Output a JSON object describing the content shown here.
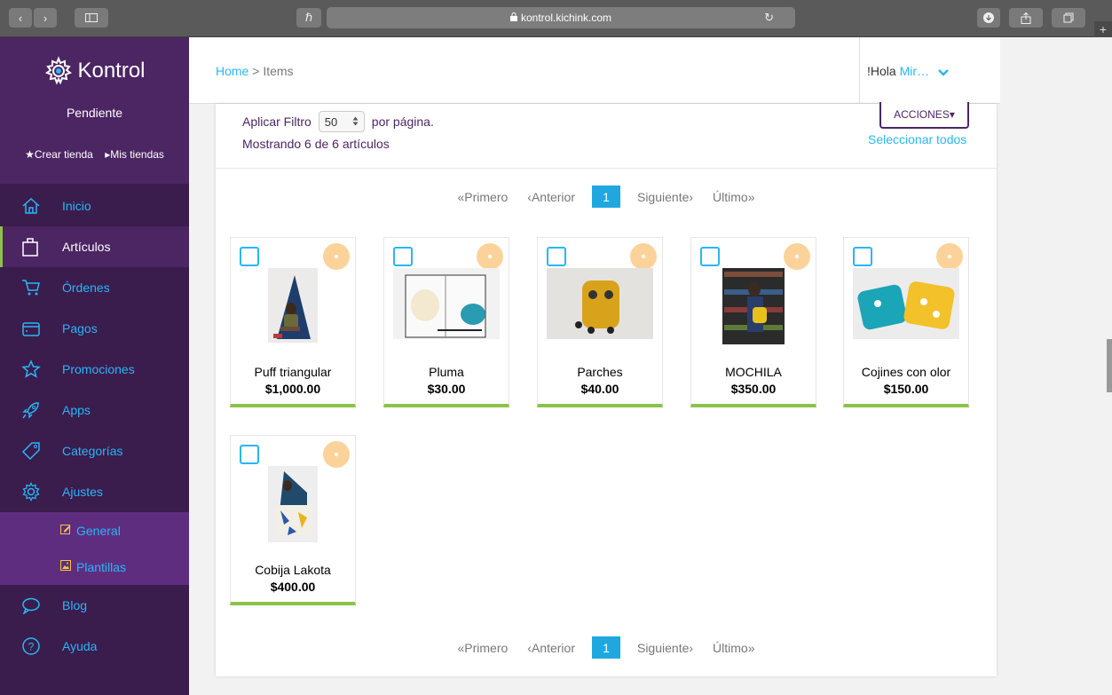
{
  "browser": {
    "url": "kontrol.kichink.com",
    "reader_label": "ℏ"
  },
  "app": {
    "name": "Kontrol"
  },
  "store": {
    "status": "Pendiente",
    "create_label": "★Crear tienda",
    "stores_label": "▸Mis tiendas"
  },
  "nav": {
    "items": [
      {
        "label": "Inicio",
        "icon": "home-icon"
      },
      {
        "label": "Artículos",
        "icon": "bag-icon"
      },
      {
        "label": "Órdenes",
        "icon": "cart-icon"
      },
      {
        "label": "Pagos",
        "icon": "wallet-icon"
      },
      {
        "label": "Promociones",
        "icon": "star-icon"
      },
      {
        "label": "Apps",
        "icon": "rocket-icon"
      },
      {
        "label": "Categorías",
        "icon": "tag-icon"
      },
      {
        "label": "Ajustes",
        "icon": "gear-icon"
      }
    ],
    "subitems": [
      {
        "label": "General",
        "icon": "edit-icon"
      },
      {
        "label": "Plantillas",
        "icon": "image-icon"
      }
    ],
    "bottom": [
      {
        "label": "Blog",
        "icon": "chat-icon"
      },
      {
        "label": "Ayuda",
        "icon": "help-icon"
      }
    ]
  },
  "header": {
    "breadcrumb_home": "Home",
    "breadcrumb_sep": " > ",
    "breadcrumb_current": "Items",
    "greeting": "!Hola ",
    "user": "Mir…",
    "chevron": "❯"
  },
  "toolbar": {
    "filter_label": "Aplicar Filtro",
    "per_page_value": "50",
    "per_page_suffix": "por página.",
    "showing": "Mostrando 6 de 6 artículos",
    "actions": "ACCIONES",
    "actions_caret": "▾",
    "select_all": "Seleccionar todos"
  },
  "pagination": {
    "first": "«Primero",
    "prev": "‹Anterior",
    "current": "1",
    "next": "Siguiente›",
    "last": "Último»"
  },
  "items": [
    {
      "title": "Puff triangular",
      "price": "$1,000.00"
    },
    {
      "title": "Pluma",
      "price": "$30.00"
    },
    {
      "title": "Parches",
      "price": "$40.00"
    },
    {
      "title": "MOCHILA",
      "price": "$350.00"
    },
    {
      "title": "Cojines con olor",
      "price": "$150.00"
    },
    {
      "title": "Cobija Lakota",
      "price": "$400.00"
    }
  ],
  "colors": {
    "sidebar_bg": "#3a1c4d",
    "sidebar_highlight": "#4c2563",
    "accent_blue": "#29b6f6",
    "accent_green": "#8bc34a",
    "badge": "#fbd39a"
  }
}
